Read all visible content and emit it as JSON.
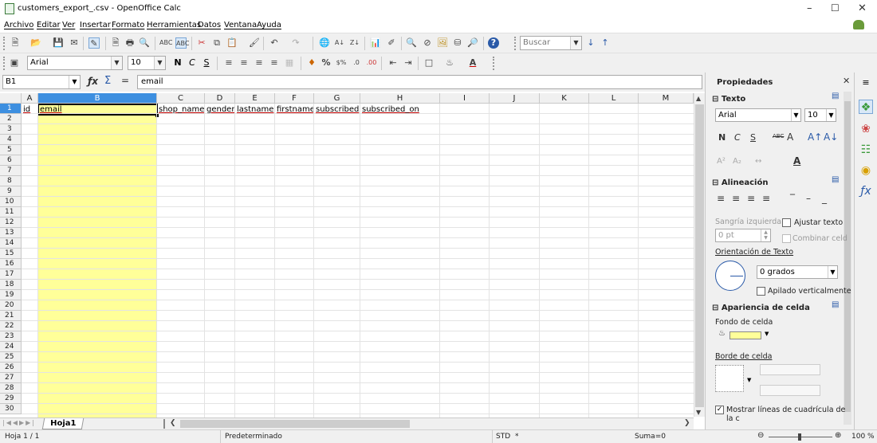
{
  "window": {
    "title": "customers_export_.csv - OpenOffice Calc"
  },
  "menu": [
    "Archivo",
    "Editar",
    "Ver",
    "Insertar",
    "Formato",
    "Herramientas",
    "Datos",
    "Ventana",
    "Ayuda"
  ],
  "toolbar": {
    "search_placeholder": "Buscar",
    "font_name": "Arial",
    "font_size": "10",
    "bold": "N",
    "italic": "C",
    "underline": "S"
  },
  "formula_bar": {
    "cell_ref": "B1",
    "content": "email"
  },
  "columns": [
    "A",
    "B",
    "C",
    "D",
    "E",
    "F",
    "G",
    "H",
    "I",
    "J",
    "K",
    "L",
    "M"
  ],
  "rows": [
    "1",
    "2",
    "3",
    "4",
    "5",
    "6",
    "7",
    "8",
    "9",
    "10",
    "11",
    "12",
    "13",
    "14",
    "15",
    "16",
    "17",
    "18",
    "19",
    "20",
    "21",
    "22",
    "23",
    "24",
    "25",
    "26",
    "27",
    "28",
    "29",
    "30"
  ],
  "row1": [
    "id",
    "email",
    "shop_name",
    "gender",
    "lastname",
    "firstname",
    "subscribed",
    "subscribed_on"
  ],
  "sheet_tab": "Hoja1",
  "status": {
    "sheet": "Hoja 1 / 1",
    "style": "Predeterminado",
    "mode": "STD",
    "modified": "*",
    "sum": "Suma=0",
    "zoom": "100 %"
  },
  "sidebar": {
    "title": "Propiedades",
    "text_section": "Texto",
    "font_name": "Arial",
    "font_size": "10",
    "align_section": "Alineación",
    "indent_label": "Sangría izquierda:",
    "indent_value": "0 pt",
    "wrap_label": "Ajustar texto",
    "merge_label": "Combinar celd",
    "orientation_label": "Orientación de Texto",
    "orientation_value": "0 grados",
    "stack_label": "Apilado verticalmente",
    "appearance_section": "Apariencia de celda",
    "bg_label": "Fondo de celda",
    "border_label": "Borde de celda",
    "gridlines_label": "Mostrar líneas de cuadrícula de la c"
  },
  "colors": {
    "selected_column": "#ffff99",
    "header_selected": "#3d8fe0"
  }
}
